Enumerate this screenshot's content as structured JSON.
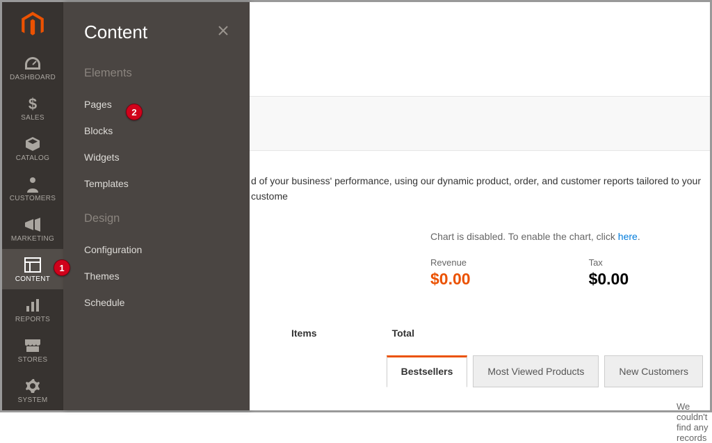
{
  "sidebar": {
    "items": [
      {
        "label": "DASHBOARD",
        "icon": "dashboard"
      },
      {
        "label": "SALES",
        "icon": "dollar"
      },
      {
        "label": "CATALOG",
        "icon": "box"
      },
      {
        "label": "CUSTOMERS",
        "icon": "person"
      },
      {
        "label": "MARKETING",
        "icon": "megaphone"
      },
      {
        "label": "CONTENT",
        "icon": "layout"
      },
      {
        "label": "REPORTS",
        "icon": "bars"
      },
      {
        "label": "STORES",
        "icon": "storefront"
      },
      {
        "label": "SYSTEM",
        "icon": "gear"
      }
    ],
    "active_index": 5
  },
  "submenu": {
    "title": "Content",
    "groups": [
      {
        "title": "Elements",
        "links": [
          "Pages",
          "Blocks",
          "Widgets",
          "Templates"
        ]
      },
      {
        "title": "Design",
        "links": [
          "Configuration",
          "Themes",
          "Schedule"
        ]
      }
    ]
  },
  "main": {
    "info_text": "d of your business' performance, using our dynamic product, order, and customer reports tailored to your custome",
    "chart_disabled_prefix": "Chart is disabled. To enable the chart, click ",
    "chart_disabled_link": "here",
    "chart_disabled_suffix": ".",
    "metrics": [
      {
        "label": "Revenue",
        "value": "$0.00",
        "accent": true
      },
      {
        "label": "Tax",
        "value": "$0.00",
        "accent": false
      }
    ],
    "cols": {
      "items": "Items",
      "total": "Total"
    },
    "tabs": [
      "Bestsellers",
      "Most Viewed Products",
      "New Customers"
    ],
    "active_tab": 0,
    "no_records": "We couldn't find any records"
  },
  "annotations": {
    "badge1": "1",
    "badge2": "2"
  }
}
